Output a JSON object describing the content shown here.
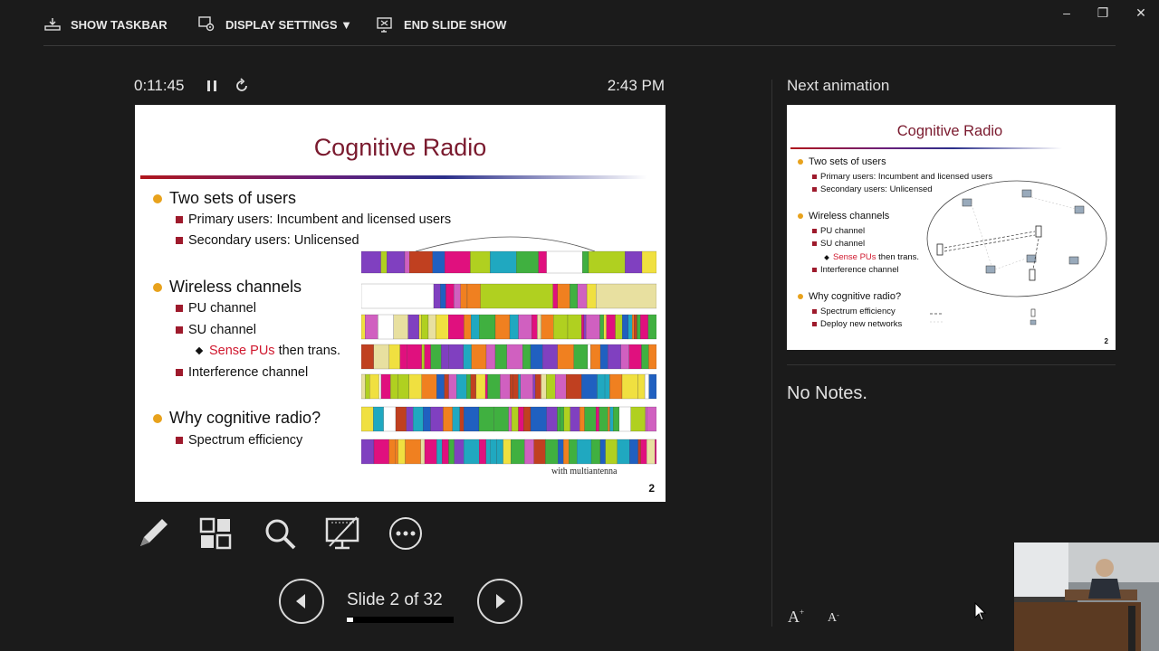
{
  "toolbar": {
    "show_taskbar": "SHOW TASKBAR",
    "display_settings": "DISPLAY SETTINGS ▼",
    "end_slide_show": "END SLIDE SHOW"
  },
  "window_controls": {
    "minimize": "–",
    "restore": "❐",
    "close": "✕"
  },
  "presenter": {
    "elapsed_time": "0:11:45",
    "clock": "2:43 PM",
    "slide_counter": "Slide 2 of 32",
    "progress_fraction": 0.0625
  },
  "current_slide": {
    "title": "Cognitive Radio",
    "bullets": [
      {
        "text": "Two sets of users",
        "subs": [
          "Primary users: Incumbent and licensed users",
          "Secondary users: Unlicensed"
        ]
      },
      {
        "text": "Wireless channels",
        "subs": [
          "PU channel",
          "SU channel"
        ],
        "sub3_highlight": "Sense PUs",
        "sub3_rest": " then trans.",
        "subs_after": [
          "Interference channel"
        ]
      },
      {
        "text": "Why cognitive radio?",
        "subs": [
          "Spectrum efficiency"
        ]
      }
    ],
    "caption": "with multiantenna",
    "page_number": "2"
  },
  "right_panel": {
    "next_label": "Next animation",
    "next_slide": {
      "title": "Cognitive Radio",
      "b1": "Two sets of users",
      "b1_subs": [
        "Primary users: Incumbent and licensed users",
        "Secondary users: Unlicensed"
      ],
      "b2": "Wireless channels",
      "b2_subs": [
        "PU channel",
        "SU channel"
      ],
      "b2_sense": "Sense PUs",
      "b2_sense_rest": " then trans.",
      "b2_last": "Interference channel",
      "b3": "Why cognitive radio?",
      "b3_subs": [
        "Spectrum efficiency",
        "Deploy new networks"
      ],
      "page_number": "2"
    },
    "notes": "No Notes."
  },
  "icons": {
    "pen": "pen-icon",
    "slides_grid": "slides-grid-icon",
    "zoom": "zoom-icon",
    "black_screen": "black-screen-icon",
    "more": "more-options-icon",
    "prev": "previous-slide-icon",
    "next": "next-slide-icon"
  },
  "colors": {
    "background": "#1b1b1b",
    "slide_title": "#7a1a2e",
    "bullet_dot": "#e8a21c",
    "bullet_square": "#9e1a2c",
    "highlight": "#d0182e"
  }
}
